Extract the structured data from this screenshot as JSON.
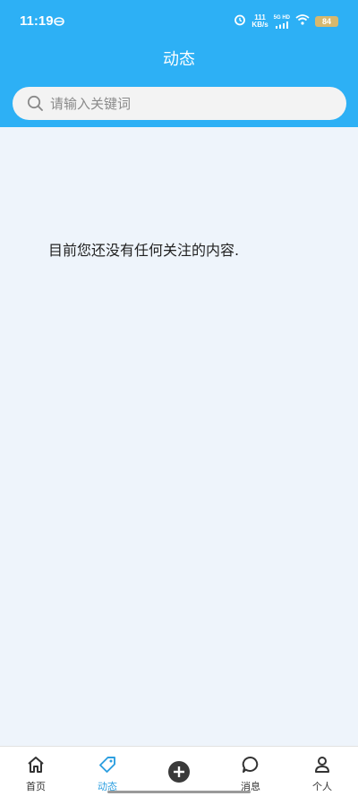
{
  "status_bar": {
    "time": "11:19",
    "net_speed_value": "111",
    "net_speed_unit": "KB/s",
    "signal_label": "5G HD",
    "battery": "84"
  },
  "header": {
    "title": "动态"
  },
  "search": {
    "placeholder": "请输入关键词"
  },
  "main": {
    "empty_message": "目前您还没有任何关注的内容."
  },
  "tabbar": {
    "tabs": [
      {
        "label": "首页",
        "icon": "home-icon"
      },
      {
        "label": "动态",
        "icon": "tag-icon",
        "active": true
      },
      {
        "label": "",
        "icon": "plus-circle-icon"
      },
      {
        "label": "消息",
        "icon": "chat-bubble-icon"
      },
      {
        "label": "个人",
        "icon": "person-icon"
      }
    ]
  },
  "colors": {
    "header_bg": "#2db0f5",
    "active_tab": "#2d9fe0",
    "page_bg": "#eef4fb"
  }
}
